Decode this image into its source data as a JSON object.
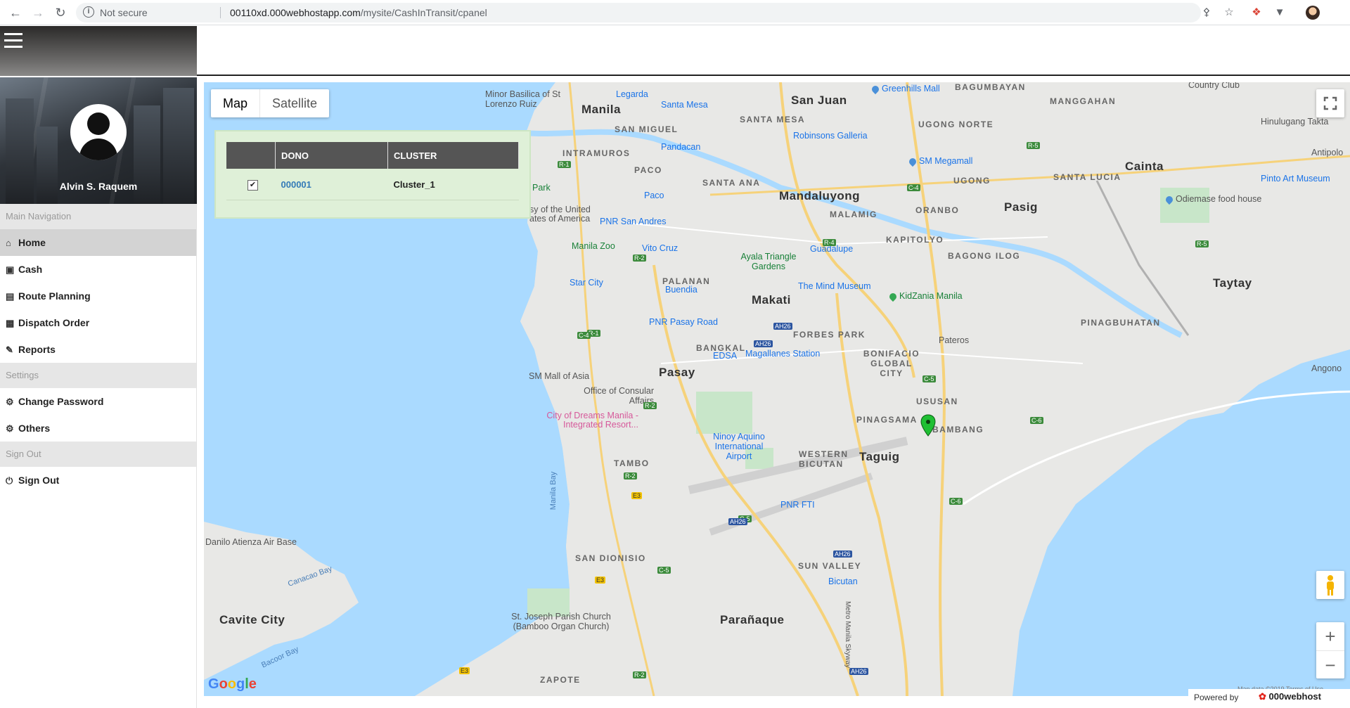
{
  "browser": {
    "security_label": "Not secure",
    "url_host": "00110xd.000webhostapp.com",
    "url_path": "/mysite/CashInTransit/cpanel"
  },
  "user": {
    "name": "Alvin S. Raquem"
  },
  "sidebar": {
    "sections": [
      {
        "header": "Main Navigation",
        "items": [
          {
            "label": "Home",
            "icon": "home-icon",
            "active": true
          },
          {
            "label": "Cash",
            "icon": "money-icon"
          },
          {
            "label": "Route Planning",
            "icon": "map-icon"
          },
          {
            "label": "Dispatch Order",
            "icon": "truck-icon"
          },
          {
            "label": "Reports",
            "icon": "edit-icon"
          }
        ]
      },
      {
        "header": "Settings",
        "items": [
          {
            "label": "Change Password",
            "icon": "gear-icon"
          },
          {
            "label": "Others",
            "icon": "gears-icon"
          }
        ]
      },
      {
        "header": "Sign Out",
        "items": [
          {
            "label": "Sign Out",
            "icon": "power-icon"
          }
        ]
      }
    ]
  },
  "map": {
    "type_buttons": [
      "Map",
      "Satellite"
    ],
    "selected_type": "Map",
    "table": {
      "headers": [
        "",
        "DONO",
        "CLUSTER"
      ],
      "rows": [
        {
          "checked": true,
          "dono": "000001",
          "cluster": "Cluster_1"
        }
      ]
    },
    "zoom_in": "+",
    "zoom_out": "−",
    "logo": "Google",
    "terms": "Map data ©2019   Terms of Use",
    "labels": {
      "manila": "Manila",
      "san_juan": "San Juan",
      "mandaluyong": "Mandaluyong",
      "pasig": "Pasig",
      "cainta": "Cainta",
      "taytay": "Taytay",
      "makati": "Makati",
      "pasay": "Pasay",
      "taguig": "Taguig",
      "paranaque": "Parañaque",
      "cavite_city": "Cavite City",
      "pateros": "Pateros",
      "angono": "Angono",
      "antipolo": "Antipolo",
      "intramuros": "INTRAMUROS",
      "paco": "PACO",
      "santa_ana": "SANTA ANA",
      "santa_mesa": "SANTA MESA",
      "san_miguel": "SAN MIGUEL",
      "malamig": "MALAMIG",
      "oranbo": "ORANBO",
      "kapitolyo": "KAPITOLYO",
      "bagong_ilog": "BAGONG ILOG",
      "ugong": "UGONG",
      "ugong_norte": "UGONG NORTE",
      "bagumbayan": "BAGUMBAYAN",
      "manggahan": "MANGGAHAN",
      "santa_lucia": "SANTA LUCIA",
      "pinagbuhatan": "PINAGBUHATAN",
      "forbes_park": "FORBES PARK",
      "bangkal": "BANGKAL",
      "bonifacio": "BONIFACIO GLOBAL CITY",
      "ususan": "USUSAN",
      "pinagsama": "PINAGSAMA",
      "bambang": "BAMBANG",
      "western_bicutan": "WESTERN BICUTAN",
      "tambo": "TAMBO",
      "san_dionisio": "SAN DIONISIO",
      "sun_valley": "SUN VALLEY",
      "zapote": "ZAPOTE",
      "palanan": "PALANAN",
      "greenhills": "Greenhills Mall",
      "country_club": "Country Club",
      "hinulugang": "Hinulugang Takta",
      "pinto": "Pinto Art Museum",
      "odiemase": "Odiemase food house",
      "robinsons": "Robinsons Galleria",
      "sm_megamall": "SM Megamall",
      "santa_mesa_poi": "Santa Mesa",
      "legarda": "Legarda",
      "minor_basilica": "Minor Basilica of St Lorenzo Ruiz",
      "pandacan": "Pandacan",
      "paco_poi": "Paco",
      "pnr_san_andres": "PNR San Andres",
      "vito_cruz": "Vito Cruz",
      "manila_zoo": "Manila Zoo",
      "star_city": "Star City",
      "guadalupe": "Guadalupe",
      "ayala": "Ayala Triangle Gardens",
      "mind_museum": "The Mind Museum",
      "kidzania": "KidZania Manila",
      "buendia": "Buendia",
      "pnr_pasay": "PNR Pasay Road",
      "edsa": "EDSA",
      "magallanes": "Magallanes Station",
      "sm_mall_asia": "SM Mall of Asia",
      "consular": "Office of Consular Affairs",
      "city_of_dreams": "City of Dreams Manila - Integrated Resort...",
      "naia": "Ninoy Aquino International Airport",
      "pnr_fti": "PNR FTI",
      "bicutan": "Bicutan",
      "danilo": "Danilo Atienza Air Base",
      "st_joseph": "St. Joseph Parish Church (Bamboo Organ Church)",
      "manila_bay": "Manila Bay",
      "canacao_bay": "Canacao Bay",
      "bacoor_bay": "Bacoor Bay",
      "us_embassy": "sy of the United ates of America",
      "park": "Park",
      "skyway": "Metro Manila Skyway"
    }
  },
  "footer": {
    "powered_by": "Powered by",
    "brand": "000webhost"
  },
  "colors": {
    "water": "#aadaff",
    "land": "#e8e8e6",
    "panel": "#dff0d8",
    "table_header": "#555555",
    "link": "#337ab7",
    "marker": "#1fbf33"
  }
}
